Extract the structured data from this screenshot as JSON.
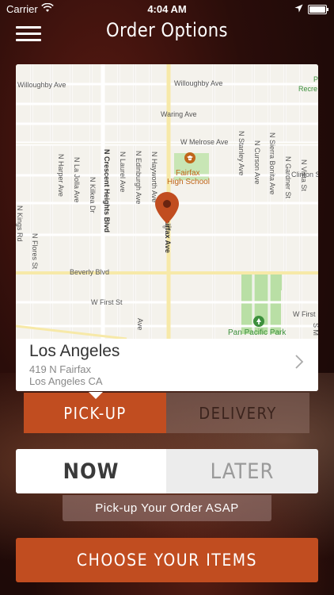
{
  "status_bar": {
    "carrier": "Carrier",
    "time": "4:04 AM",
    "icons": [
      "wifi-icon",
      "location-arrow-icon",
      "battery-icon"
    ]
  },
  "nav": {
    "title": "Order Options",
    "menu_icon": "hamburger-menu-icon"
  },
  "map": {
    "streets": {
      "willoughby_left": "Willoughby Ave",
      "willoughby_right": "Willoughby Ave",
      "waring": "Waring Ave",
      "melrose": "W Melrose Ave",
      "beverly": "Beverly Blvd",
      "first_left": "W First St",
      "first_right": "W First",
      "clinton": "Clinton S",
      "fairfax": "Fairfax Ave",
      "harper": "N Harper Ave",
      "la_jolla": "N La Jolla Ave",
      "kilkea": "N Kilkea Dr",
      "crescent_heights": "N Crescent Heights Blvd",
      "laurel": "N Laurel Ave",
      "edinburgh": "N Edinburgh Ave",
      "hayworth": "N Hayworth Ave",
      "stanley": "N Stanley Ave",
      "curson": "N Curson Ave",
      "sierra_bonita": "N Sierra Bonita Ave",
      "gardner": "N Gardner St",
      "vista": "N Vista St",
      "kings": "N Kings Rd",
      "flores": "N Flores St",
      "ave_stub": "Ave",
      "s_stub": "S M"
    },
    "pois": {
      "school_line1": "Fairfax",
      "school_line2": "High School",
      "park": "Pan Pacific Park",
      "recreation_1": "P",
      "recreation_2": "Recre"
    },
    "pin_icon": "map-pin-icon",
    "school_icon": "graduation-cap-icon",
    "park_icon": "tree-icon"
  },
  "store": {
    "city": "Los Angeles",
    "address_line1": "419 N Fairfax",
    "address_line2": "Los Angeles CA",
    "chevron_icon": "chevron-right-icon"
  },
  "order_type": {
    "pickup_label": "PICK-UP",
    "delivery_label": "DELIVERY",
    "selected": "PICK-UP"
  },
  "timing": {
    "now_label": "NOW",
    "later_label": "LATER",
    "selected": "NOW",
    "info_text": "Pick-up Your Order ASAP"
  },
  "cta": {
    "label": "CHOOSE YOUR ITEMS"
  },
  "colors": {
    "accent": "#c14d20",
    "background": "#2a0d0a"
  }
}
